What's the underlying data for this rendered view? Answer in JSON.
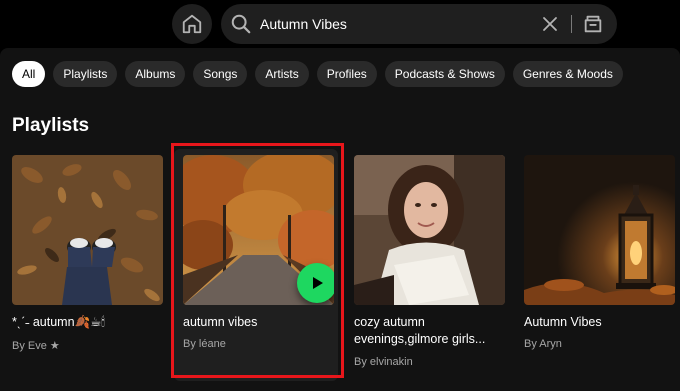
{
  "search": {
    "query": "Autumn Vibes"
  },
  "icons": {
    "home": "home-icon",
    "search": "search-icon",
    "clear": "close-icon",
    "browse": "browse-icon",
    "play": "play-icon"
  },
  "filters": [
    {
      "label": "All",
      "selected": true
    },
    {
      "label": "Playlists",
      "selected": false
    },
    {
      "label": "Albums",
      "selected": false
    },
    {
      "label": "Songs",
      "selected": false
    },
    {
      "label": "Artists",
      "selected": false
    },
    {
      "label": "Profiles",
      "selected": false
    },
    {
      "label": "Podcasts & Shows",
      "selected": false
    },
    {
      "label": "Genres & Moods",
      "selected": false
    }
  ],
  "section": {
    "title": "Playlists"
  },
  "playlists": [
    {
      "title": "*ˎˊ˗ autumn🍂☕🕯",
      "owner": "By Eve ★"
    },
    {
      "title": "autumn vibes",
      "owner": "By léane"
    },
    {
      "title": "cozy autumn evenings,gilmore girls...",
      "owner": "By elvinakin"
    },
    {
      "title": "Autumn Vibes",
      "owner": "By Aryn"
    }
  ],
  "colors": {
    "accent": "#1ed760",
    "highlight_border": "#e8161b",
    "background": "#121212",
    "chip": "#2a2a2a"
  }
}
